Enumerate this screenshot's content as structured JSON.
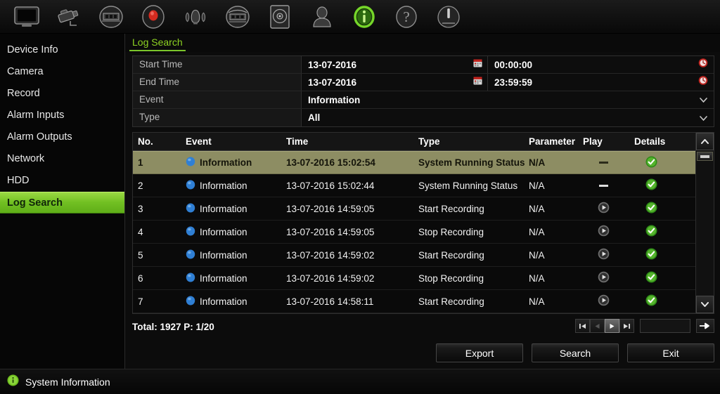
{
  "toolbar": {
    "items": [
      {
        "name": "monitor-icon",
        "title": "Live View"
      },
      {
        "name": "camera-icon",
        "title": "Camera"
      },
      {
        "name": "playback-icon",
        "title": "Playback"
      },
      {
        "name": "record-icon",
        "title": "Record"
      },
      {
        "name": "alarm-icon",
        "title": "Alarm"
      },
      {
        "name": "network-icon",
        "title": "Network"
      },
      {
        "name": "hdd-icon",
        "title": "HDD"
      },
      {
        "name": "user-icon",
        "title": "User"
      },
      {
        "name": "info-icon",
        "title": "System Information"
      },
      {
        "name": "help-icon",
        "title": "Help"
      },
      {
        "name": "power-icon",
        "title": "Shutdown"
      }
    ],
    "active_index": 8
  },
  "sidebar": {
    "items": [
      {
        "label": "Device Info",
        "active": false
      },
      {
        "label": "Camera",
        "active": false
      },
      {
        "label": "Record",
        "active": false
      },
      {
        "label": "Alarm Inputs",
        "active": false
      },
      {
        "label": "Alarm Outputs",
        "active": false
      },
      {
        "label": "Network",
        "active": false
      },
      {
        "label": "HDD",
        "active": false
      },
      {
        "label": "Log Search",
        "active": true
      }
    ]
  },
  "tab": {
    "label": "Log Search"
  },
  "form": {
    "start_time": {
      "label": "Start Time",
      "date": "13-07-2016",
      "time": "00:00:00",
      "calendar_icon": "calendar-icon",
      "clock_icon": "clock-icon"
    },
    "end_time": {
      "label": "End Time",
      "date": "13-07-2016",
      "time": "23:59:59",
      "calendar_icon": "calendar-icon",
      "clock_icon": "clock-icon"
    },
    "event": {
      "label": "Event",
      "value": "Information",
      "chevron": "chevron-down-icon"
    },
    "type": {
      "label": "Type",
      "value": "All",
      "chevron": "chevron-down-icon"
    }
  },
  "table": {
    "headers": [
      "No.",
      "Event",
      "Time",
      "Type",
      "Parameter",
      "Play",
      "Details"
    ],
    "rows": [
      {
        "no": "1",
        "event": "Information",
        "time": "13-07-2016 15:02:54",
        "type": "System Running Status",
        "parameter": "N/A",
        "play": "dash",
        "details": "check",
        "selected": true
      },
      {
        "no": "2",
        "event": "Information",
        "time": "13-07-2016 15:02:44",
        "type": "System Running Status",
        "parameter": "N/A",
        "play": "dash",
        "details": "check",
        "selected": false
      },
      {
        "no": "3",
        "event": "Information",
        "time": "13-07-2016 14:59:05",
        "type": "Start Recording",
        "parameter": "N/A",
        "play": "play-button",
        "details": "check",
        "selected": false
      },
      {
        "no": "4",
        "event": "Information",
        "time": "13-07-2016 14:59:05",
        "type": "Stop Recording",
        "parameter": "N/A",
        "play": "play-button",
        "details": "check",
        "selected": false
      },
      {
        "no": "5",
        "event": "Information",
        "time": "13-07-2016 14:59:02",
        "type": "Start Recording",
        "parameter": "N/A",
        "play": "play-button",
        "details": "check",
        "selected": false
      },
      {
        "no": "6",
        "event": "Information",
        "time": "13-07-2016 14:59:02",
        "type": "Stop Recording",
        "parameter": "N/A",
        "play": "play-button",
        "details": "check",
        "selected": false
      },
      {
        "no": "7",
        "event": "Information",
        "time": "13-07-2016 14:58:11",
        "type": "Start Recording",
        "parameter": "N/A",
        "play": "play-button",
        "details": "check",
        "selected": false
      }
    ]
  },
  "footer": {
    "total_text": "Total: 1927  P: 1/20",
    "pager": {
      "first": "first-page-icon",
      "prev": "prev-page-icon",
      "next": "next-page-icon",
      "last": "last-page-icon",
      "page_input_value": "",
      "go": "go-icon"
    }
  },
  "actions": {
    "export_label": "Export",
    "search_label": "Search",
    "exit_label": "Exit"
  },
  "statusbar": {
    "icon": "info-icon",
    "label": "System Information"
  },
  "colors": {
    "accent_green": "#7bc62b",
    "sidebar_active_green": "#72c023",
    "row_selected": "#8d8d63",
    "calendar_red": "#c9322d",
    "info_blue": "#2f7fd4",
    "check_green": "#3fa82a"
  }
}
